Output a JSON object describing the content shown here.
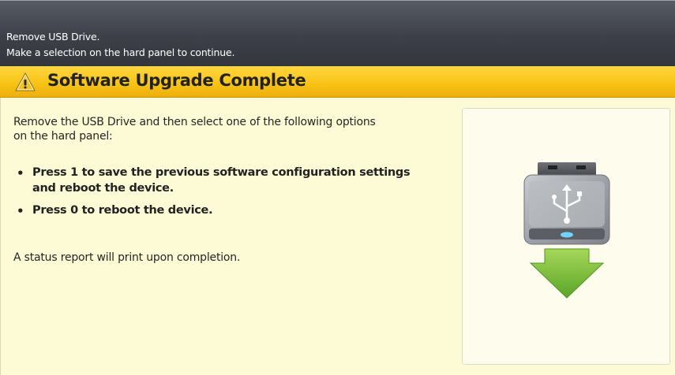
{
  "header": {
    "line1": "Remove USB Drive.",
    "line2": "Make a selection on the hard panel to continue."
  },
  "dialog": {
    "title": "Software Upgrade Complete",
    "icon": "warning-icon",
    "intro_line1": "Remove the USB Drive and then select one of the following options",
    "intro_line2": "on the hard panel:",
    "options": [
      {
        "bullet": "•",
        "line1": "Press 1 to save the previous software configuration settings",
        "line2": "and reboot the device."
      },
      {
        "bullet": "•",
        "line1": "Press 0 to reboot the device."
      }
    ],
    "status_text": "A status report will print upon completion.",
    "illustration": "usb-drive-remove-icon"
  },
  "colors": {
    "header_bg": "#3d4048",
    "title_bar_bg": "#f8c417",
    "content_bg": "#fdfbd6",
    "arrow_green": "#7cc142"
  }
}
